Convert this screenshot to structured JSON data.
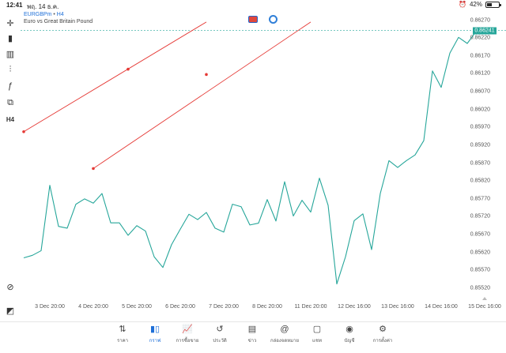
{
  "status_bar": {
    "time": "12:41",
    "date": "พฤ. 14 ธ.ค.",
    "battery": "42%",
    "battery_level": 0.42
  },
  "toolbar": [
    {
      "name": "crosshair-icon",
      "glyph": "✛"
    },
    {
      "name": "candlestick-type-icon",
      "glyph": "▮"
    },
    {
      "name": "bar-chart-icon",
      "glyph": "▥"
    },
    {
      "name": "indicators-icon",
      "glyph": "⫶"
    },
    {
      "name": "function-icon",
      "glyph": "ƒ"
    },
    {
      "name": "objects-icon",
      "glyph": "⧉"
    },
    {
      "name": "timeframe-h4",
      "glyph": "H4"
    },
    {
      "name": "zoom-icon",
      "glyph": "⊘"
    },
    {
      "name": "app-logo-icon",
      "glyph": "◩"
    }
  ],
  "symbol": {
    "name": "EURGBPm",
    "separator": "•",
    "timeframe": "H4",
    "description": "Euro vs Great Britain Pound"
  },
  "chart_data": {
    "type": "line",
    "series": [
      {
        "color": "#26a69a",
        "values": [
          0.85605,
          0.85612,
          0.85625,
          0.85808,
          0.85693,
          0.85688,
          0.85755,
          0.8577,
          0.85758,
          0.85785,
          0.85703,
          0.85703,
          0.85668,
          0.85695,
          0.8568,
          0.85608,
          0.85578,
          0.85642,
          0.85685,
          0.85727,
          0.85712,
          0.85732,
          0.85688,
          0.85677,
          0.85755,
          0.85748,
          0.85697,
          0.85702,
          0.85768,
          0.85708,
          0.85818,
          0.85722,
          0.85766,
          0.85733,
          0.85828,
          0.85752,
          0.85532,
          0.85608,
          0.85709,
          0.85728,
          0.85628,
          0.85785,
          0.85877,
          0.85858,
          0.85877,
          0.85893,
          0.85933,
          0.86128,
          0.86082,
          0.86178,
          0.86222,
          0.86205,
          0.86238,
          0.86241
        ]
      }
    ],
    "ylim": [
      0.855,
      0.863
    ],
    "y_ticks": [
      "0.86270",
      "0.86220",
      "0.86170",
      "0.86120",
      "0.86070",
      "0.86020",
      "0.85970",
      "0.85920",
      "0.85870",
      "0.85820",
      "0.85770",
      "0.85720",
      "0.85670",
      "0.85620",
      "0.85570",
      "0.85520"
    ],
    "x_ticks": [
      "3 Dec 20:00",
      "4 Dec 20:00",
      "5 Dec 20:00",
      "6 Dec 20:00",
      "7 Dec 20:00",
      "8 Dec 20:00",
      "11 Dec 20:00",
      "12 Dec 16:00",
      "13 Dec 16:00",
      "14 Dec 16:00",
      "15 Dec 16:00"
    ],
    "x_tick_positions": [
      3,
      8,
      13,
      18,
      23,
      28,
      33,
      38,
      43,
      48,
      53
    ],
    "last_price": "0.86241",
    "current_price": 0.86241,
    "grid": false,
    "trend_lines": [
      {
        "color": "#e53935",
        "points": [
          [
            0,
            0.85958
          ],
          [
            12,
            0.86133
          ],
          [
            21,
            0.86265
          ]
        ]
      },
      {
        "color": "#e53935",
        "points": [
          [
            8,
            0.85855
          ],
          [
            21,
            0.86118
          ],
          [
            33,
            0.86265
          ]
        ]
      }
    ]
  },
  "bottom_nav": [
    {
      "name": "nav-quotes",
      "icon": "⇅",
      "label": "ราคา"
    },
    {
      "name": "nav-chart",
      "icon": "▮▯",
      "label": "กราฟ",
      "active": true
    },
    {
      "name": "nav-trade",
      "icon": "📈",
      "label": "การซื้อขาย"
    },
    {
      "name": "nav-history",
      "icon": "↺",
      "label": "ประวัติ"
    },
    {
      "name": "nav-news",
      "icon": "▤",
      "label": "ข่าว"
    },
    {
      "name": "nav-mailbox",
      "icon": "@",
      "label": "กล่องจดหมาย"
    },
    {
      "name": "nav-chat",
      "icon": "▢",
      "label": "แชท"
    },
    {
      "name": "nav-accounts",
      "icon": "◉",
      "label": "บัญชี"
    },
    {
      "name": "nav-settings",
      "icon": "⚙",
      "label": "การตั้งค่า"
    }
  ]
}
